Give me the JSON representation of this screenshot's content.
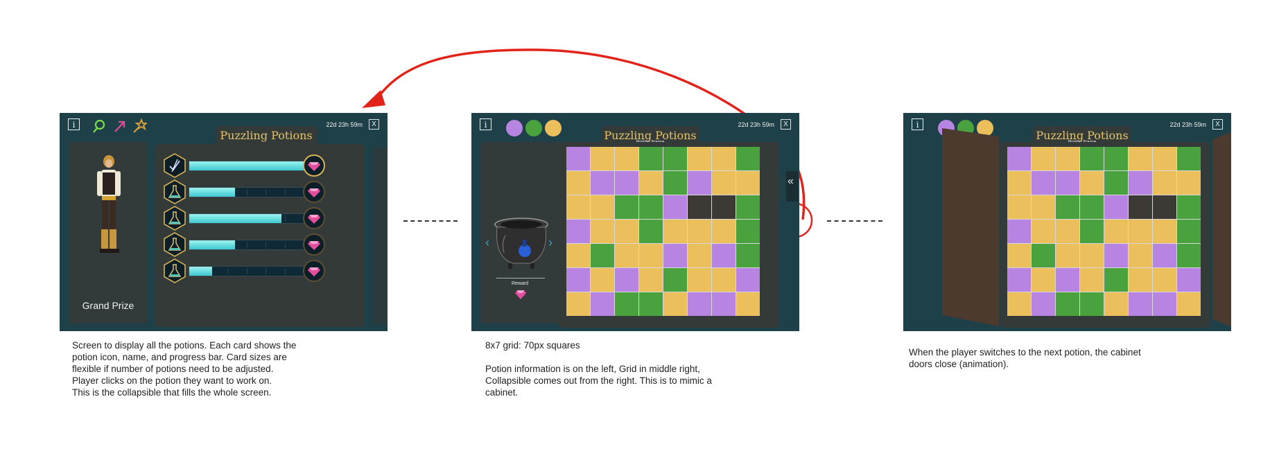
{
  "screen1": {
    "info_label": "i",
    "title": "Puzzling Potions",
    "timer": "22d 23h 59m",
    "close_label": "X",
    "prize_label": "Grand Prize",
    "header_icons": [
      "magnifier-wand-icon",
      "arrow-wand-icon",
      "star-wand-icon"
    ],
    "potions": [
      {
        "icon": "quill-check-icon",
        "progress": 1.0
      },
      {
        "icon": "flask-icon",
        "progress": 0.4
      },
      {
        "icon": "flask-icon",
        "progress": 0.8
      },
      {
        "icon": "flask-icon",
        "progress": 0.4
      },
      {
        "icon": "flask-icon",
        "progress": 0.2
      }
    ]
  },
  "screen2": {
    "info_label": "i",
    "title": "Puzzling Potions",
    "subtitle": "Potion Name",
    "timer": "22d 23h 59m",
    "close_label": "X",
    "reward_label": "Reward",
    "collapse_glyph": "«",
    "color_dots": [
      "#b784e1",
      "#4aa23e",
      "#eabf5c"
    ]
  },
  "screen3": {
    "info_label": "i",
    "title": "Puzzling Potions",
    "subtitle": "Potion Name",
    "timer": "22d 23h 59m",
    "close_label": "X",
    "color_dots": [
      "#b784e1",
      "#4aa23e",
      "#eabf5c"
    ]
  },
  "grid": {
    "colors": {
      "P": "#b784e1",
      "G": "#4aa23e",
      "Y": "#eabf5c",
      "D": "#3d3a35"
    },
    "rows": [
      [
        "P",
        "Y",
        "Y",
        "G",
        "G",
        "Y",
        "Y",
        "G"
      ],
      [
        "Y",
        "P",
        "P",
        "Y",
        "G",
        "P",
        "Y",
        "Y"
      ],
      [
        "Y",
        "Y",
        "G",
        "G",
        "P",
        "D",
        "D",
        "G"
      ],
      [
        "P",
        "Y",
        "Y",
        "G",
        "Y",
        "Y",
        "Y",
        "G"
      ],
      [
        "Y",
        "G",
        "Y",
        "Y",
        "P",
        "Y",
        "P",
        "G"
      ],
      [
        "P",
        "Y",
        "P",
        "Y",
        "G",
        "Y",
        "Y",
        "P"
      ],
      [
        "Y",
        "P",
        "G",
        "G",
        "Y",
        "P",
        "P",
        "Y"
      ]
    ]
  },
  "captions": {
    "caption1": [
      "Screen to display all the potions. Each card shows the",
      "potion icon, name, and progress bar. Card sizes are",
      "flexible if number of potions need to be adjusted.",
      "Player clicks on the potion they want to work on.",
      "This is the collapsible that fills the whole screen."
    ],
    "caption2a": "8x7 grid: 70px squares",
    "caption2b": [
      "Potion information is on the left, Grid in middle right,",
      "Collapsible comes out from the right. This is to mimic a",
      "cabinet."
    ],
    "caption3": [
      "When the player switches to the next potion, the cabinet",
      "doors close (animation)."
    ]
  },
  "accent_colors": {
    "arrow": "#e2231a",
    "title_gold": "#e6c56a",
    "screen_bg": "#1e4049"
  }
}
